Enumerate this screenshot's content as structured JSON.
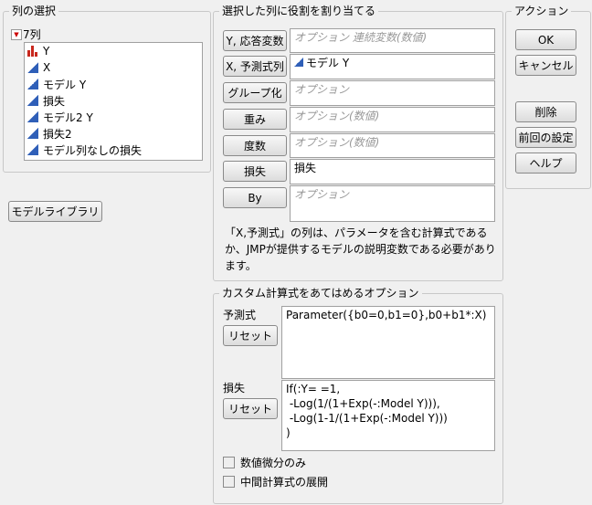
{
  "columns": {
    "title": "列の選択",
    "count": "7列",
    "items": [
      {
        "label": "Y",
        "icon": "nominal-bar-icon"
      },
      {
        "label": "X",
        "icon": "continuous-icon"
      },
      {
        "label": "モデル Y",
        "icon": "continuous-icon"
      },
      {
        "label": "損失",
        "icon": "continuous-icon"
      },
      {
        "label": "モデル2 Y",
        "icon": "continuous-icon"
      },
      {
        "label": "損失2",
        "icon": "continuous-icon"
      },
      {
        "label": "モデル列なしの損失",
        "icon": "continuous-icon"
      }
    ]
  },
  "model_library": "モデルライブラリ",
  "roles": {
    "title": "選択した列に役割を割り当てる",
    "items": [
      {
        "button": "Y, 応答変数",
        "value": "",
        "placeholder": "オプション 連続変数(数値)"
      },
      {
        "button": "X, 予測式列",
        "value": "モデル Y",
        "placeholder": ""
      },
      {
        "button": "グループ化",
        "value": "",
        "placeholder": "オプション"
      },
      {
        "button": "重み",
        "value": "",
        "placeholder": "オプション(数値)"
      },
      {
        "button": "度数",
        "value": "",
        "placeholder": "オプション(数値)"
      },
      {
        "button": "損失",
        "value": "損失",
        "placeholder": ""
      },
      {
        "button": "By",
        "value": "",
        "placeholder": "オプション"
      }
    ],
    "note": "「X,予測式」の列は、パラメータを含む計算式であるか、JMPが提供するモデルの説明変数である必要があります。"
  },
  "actions": {
    "title": "アクション",
    "ok": "OK",
    "cancel": "キャンセル",
    "remove": "削除",
    "recall": "前回の設定",
    "help": "ヘルプ"
  },
  "custom": {
    "title": "カスタム計算式をあてはめるオプション",
    "pred_label": "予測式",
    "pred_reset": "リセット",
    "pred_formula": "Parameter({b0=0,b1=0},b0+b1*:X)",
    "loss_label": "損失",
    "loss_reset": "リセット",
    "loss_formula": "If(:Y= =1,\n -Log(1/(1+Exp(-:Model Y))),\n -Log(1-1/(1+Exp(-:Model Y)))\n)",
    "numeric_deriv": "数値微分のみ",
    "expand_intermediate": "中間計算式の展開"
  }
}
